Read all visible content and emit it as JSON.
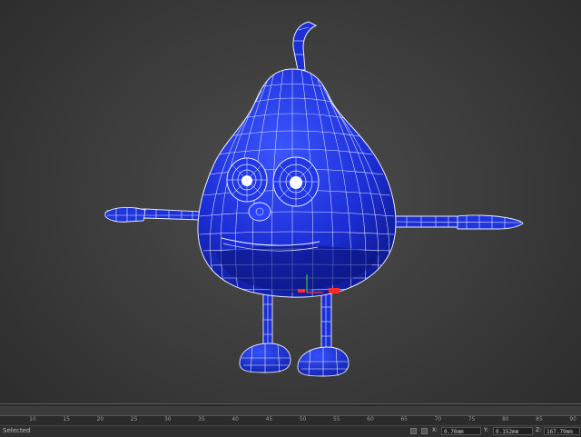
{
  "viewport": {
    "background_color": "#3c3c3c",
    "model_color": "#1c2fd6",
    "wire_color": "#e8ecff"
  },
  "timeline": {
    "tick_labels": [
      "10",
      "15",
      "20",
      "25",
      "30",
      "35",
      "40",
      "45",
      "50",
      "55",
      "60",
      "65",
      "70",
      "75",
      "80",
      "85",
      "90"
    ]
  },
  "status": {
    "selection_text": "Selected",
    "x_label": "X:",
    "x_value": "0.76mm",
    "y_label": "Y:",
    "y_value": "0.152mm",
    "z_label": "Z:",
    "z_value": "167.79mm"
  }
}
